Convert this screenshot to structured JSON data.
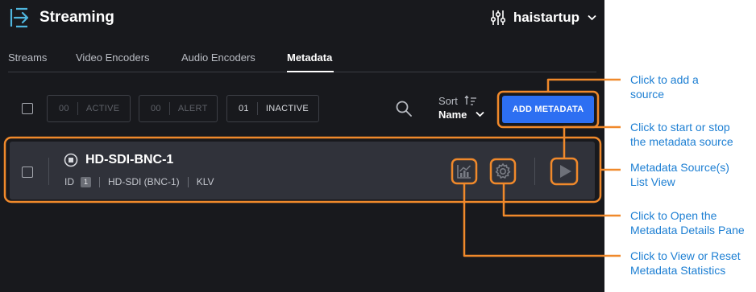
{
  "header": {
    "app_title": "Streaming",
    "logo_icon": "sign-in-arrow-icon",
    "settings_icon": "sliders-icon",
    "username": "haistartup",
    "user_menu_icon": "chevron-down-icon"
  },
  "tabs": [
    {
      "label": "Streams",
      "active": false
    },
    {
      "label": "Video Encoders",
      "active": false
    },
    {
      "label": "Audio Encoders",
      "active": false
    },
    {
      "label": "Metadata",
      "active": true
    }
  ],
  "toolbar": {
    "filters": [
      {
        "count": "00",
        "label": "ACTIVE"
      },
      {
        "count": "00",
        "label": "ALERT"
      },
      {
        "count": "01",
        "label": "INACTIVE"
      }
    ],
    "search_icon": "search-icon",
    "sort_label": "Sort",
    "sort_value": "Name",
    "add_button_label": "ADD METADATA"
  },
  "source": {
    "name": "HD-SDI-BNC-1",
    "status_icon": "stop-circle-icon",
    "id_label": "ID",
    "id_value": "1",
    "input": "HD-SDI (BNC-1)",
    "type": "KLV",
    "stats_icon": "statistics-chart-icon",
    "details_icon": "gear-icon",
    "play_icon": "play-icon"
  },
  "callouts": [
    {
      "line1": "Click to add a",
      "line2": "source"
    },
    {
      "line1": "Click to start or stop",
      "line2": "the metadata source"
    },
    {
      "line1": "Metadata Source(s)",
      "line2": "List View"
    },
    {
      "line1": "Click to Open the",
      "line2": "Metadata Details Pane"
    },
    {
      "line1": "Click to View or Reset",
      "line2": "Metadata Statistics"
    }
  ],
  "colors": {
    "background": "#18191d",
    "row_background": "#30323a",
    "accent_blue": "#2d6ff2",
    "annotation_orange": "#f0892b",
    "callout_text": "#1d7fd3"
  }
}
